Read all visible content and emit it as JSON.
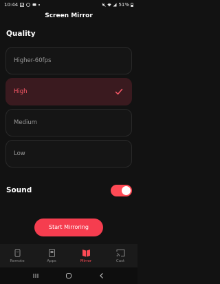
{
  "status_bar": {
    "time": "10:44",
    "battery": "51%",
    "left_icons": [
      "gallery-icon",
      "whatsapp-icon",
      "message-icon",
      "dot-icon"
    ],
    "right_icons": [
      "mute-icon",
      "wifi-icon",
      "signal-icon",
      "battery-icon"
    ]
  },
  "header": {
    "title": "Screen Mirror"
  },
  "quality": {
    "title": "Quality",
    "options": [
      {
        "label": "Higher-60fps",
        "selected": false
      },
      {
        "label": "High",
        "selected": true
      },
      {
        "label": "Medium",
        "selected": false
      },
      {
        "label": "Low",
        "selected": false
      }
    ]
  },
  "sound": {
    "title": "Sound",
    "enabled": true
  },
  "start_button": {
    "label": "Start Mirroring"
  },
  "bottom_nav": {
    "items": [
      {
        "label": "Remote",
        "icon": "remote-icon",
        "active": false
      },
      {
        "label": "Apps",
        "icon": "apps-icon",
        "active": false
      },
      {
        "label": "Mirror",
        "icon": "mirror-icon",
        "active": true
      },
      {
        "label": "Cast",
        "icon": "cast-icon",
        "active": false
      }
    ]
  },
  "colors": {
    "accent": "#f53d4f",
    "background": "#121212",
    "selected_bg": "#3a1a1f"
  }
}
